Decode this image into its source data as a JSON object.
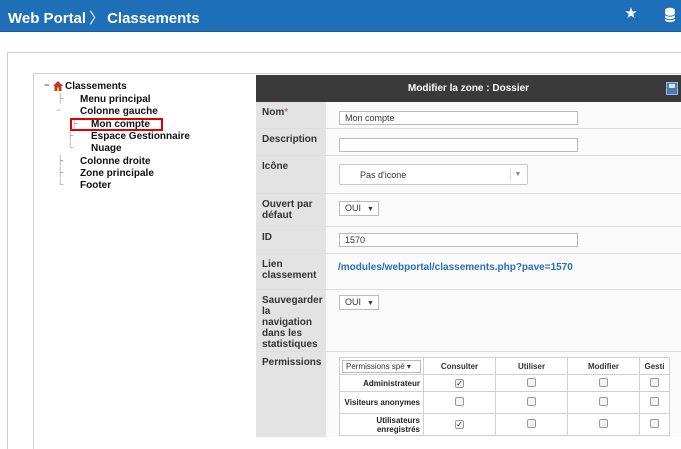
{
  "header": {
    "app": "Web Portal",
    "separator": "〉",
    "page": "Classements",
    "icons": [
      "star-icon",
      "database-icon"
    ]
  },
  "tree": {
    "root": "Classements",
    "items": [
      {
        "label": "Menu principal",
        "level": 1
      },
      {
        "label": "Colonne gauche",
        "level": 1
      },
      {
        "label": "Mon compte",
        "level": 2,
        "selected": true
      },
      {
        "label": "Espace Gestionnaire",
        "level": 2
      },
      {
        "label": "Nuage",
        "level": 2
      },
      {
        "label": "Colonne droite",
        "level": 1
      },
      {
        "label": "Zone principale",
        "level": 1
      },
      {
        "label": "Footer",
        "level": 1
      }
    ],
    "selected_color": "#e00000"
  },
  "form": {
    "title": "Modifier la zone : Dossier",
    "nom_label": "Nom",
    "required_mark": "*",
    "nom_value": "Mon compte",
    "description_label": "Description",
    "description_value": "",
    "icone_label": "Icône",
    "icone_value": "Pas d'icone",
    "ouvert_label": "Ouvert par défaut",
    "ouvert_value": "OUI",
    "id_label": "ID",
    "id_value": "1570",
    "lien_label": "Lien classement",
    "lien_value": "/modules/webportal/classements.php?pave=1570",
    "sauvegarder_label": "Sauvegarder la navigation dans les statistiques",
    "sauvegarder_value": "OUI",
    "permissions_label": "Permissions",
    "permissions_select": "Permissions spé",
    "permission_columns": [
      "Consulter",
      "Utiliser",
      "Modifier",
      "Gesti"
    ],
    "permission_rows": [
      {
        "label": "Administrateur",
        "values": [
          true,
          false,
          false,
          false
        ]
      },
      {
        "label": "Visiteurs anonymes",
        "values": [
          false,
          false,
          false,
          false
        ]
      },
      {
        "label": "Utilisateurs enregistrés",
        "values": [
          true,
          false,
          false,
          false
        ]
      }
    ],
    "accent": "#2670b8"
  },
  "colors": {
    "topbar": "#1f6fb8",
    "panel_header": "#3a3a3a",
    "label_bg": "#e3e3e3"
  }
}
